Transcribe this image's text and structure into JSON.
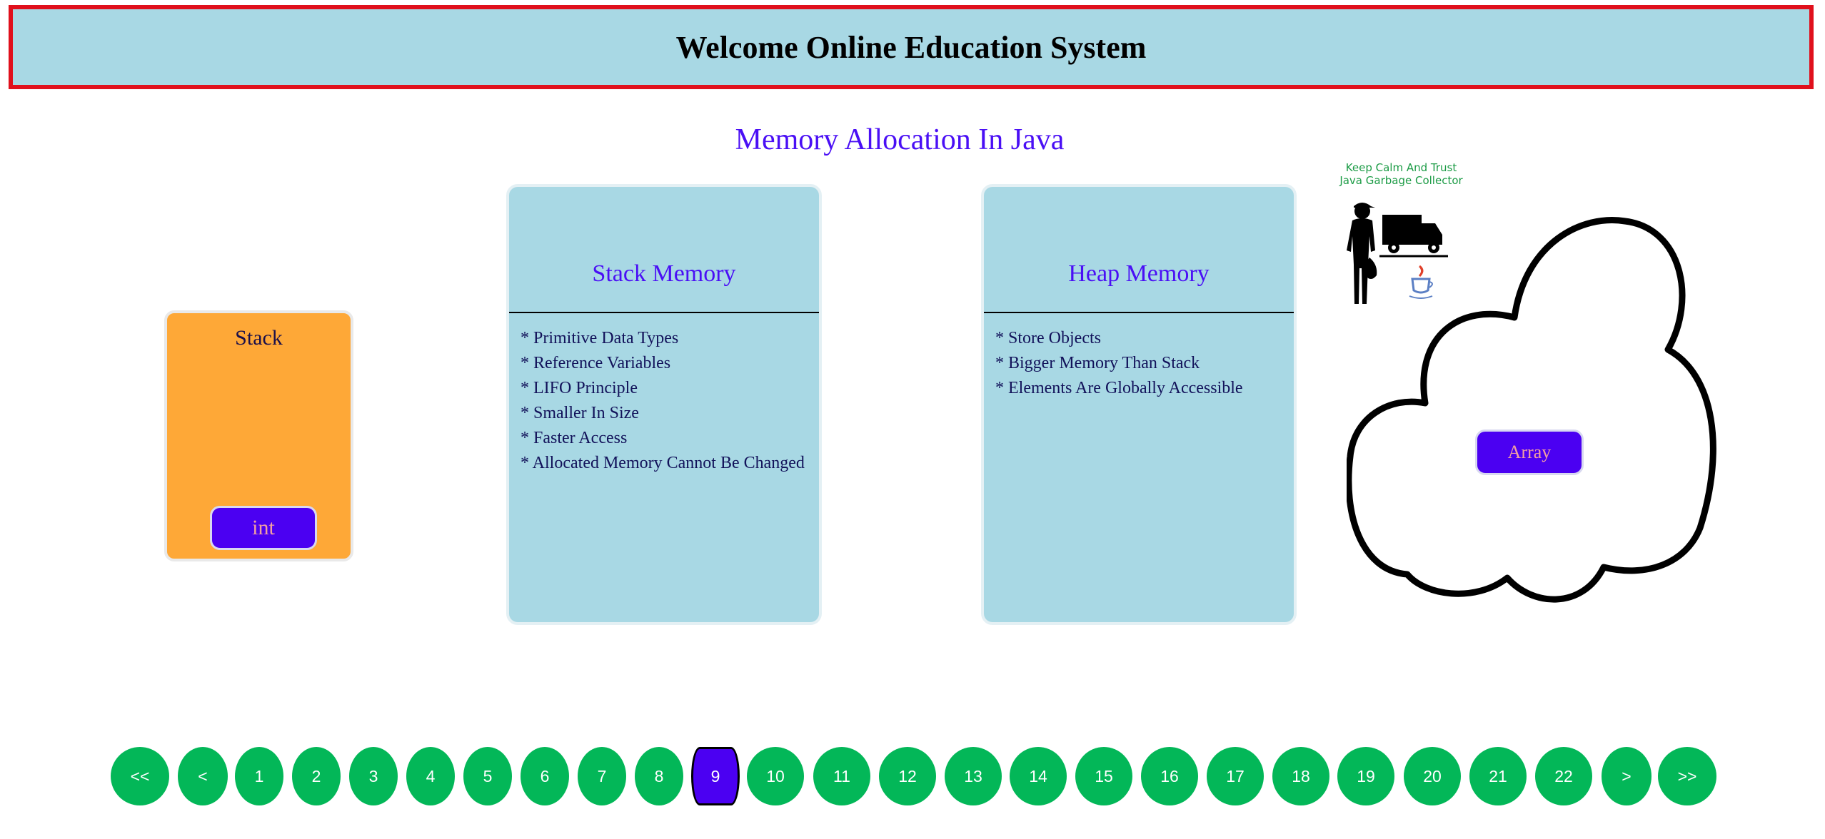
{
  "header": {
    "title": "Welcome Online Education System"
  },
  "page_title": "Memory Allocation In Java",
  "stack_box": {
    "label": "Stack",
    "button_label": "int"
  },
  "stack_memory": {
    "title": "Stack Memory",
    "items": [
      "* Primitive Data Types",
      "* Reference Variables",
      "* LIFO Principle",
      "* Smaller In Size",
      "* Faster Access",
      "* Allocated Memory Cannot Be Changed"
    ]
  },
  "heap_memory": {
    "title": "Heap Memory",
    "items": [
      "* Store Objects",
      "* Bigger Memory Than Stack",
      "* Elements Are Globally Accessible"
    ]
  },
  "garbage_collector": {
    "line1": "Keep Calm And Trust",
    "line2": "Java Garbage Collector"
  },
  "heap_cloud": {
    "button_label": "Array"
  },
  "pagination": {
    "items": [
      "<<",
      "<",
      "1",
      "2",
      "3",
      "4",
      "5",
      "6",
      "7",
      "8",
      "9",
      "10",
      "11",
      "12",
      "13",
      "14",
      "15",
      "16",
      "17",
      "18",
      "19",
      "20",
      "21",
      "22",
      ">",
      ">>"
    ],
    "active": "9"
  },
  "colors": {
    "header_bg": "#a8d8e4",
    "header_border": "#e0101c",
    "accent_purple": "#4b00f2",
    "stack_orange": "#fea837",
    "pager_green": "#03b758"
  }
}
